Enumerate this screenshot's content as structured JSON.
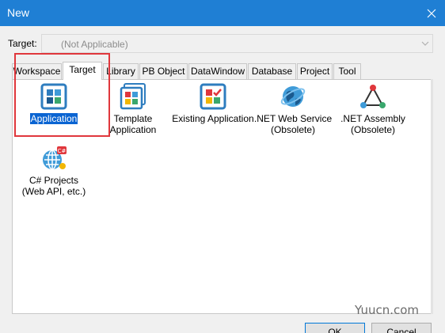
{
  "window": {
    "title": "New"
  },
  "target": {
    "label": "Target:",
    "value": "(Not Applicable)"
  },
  "tabs": [
    {
      "label": "Workspace",
      "active": false
    },
    {
      "label": "Target",
      "active": true
    },
    {
      "label": "Library",
      "active": false
    },
    {
      "label": "PB Object",
      "active": false
    },
    {
      "label": "DataWindow",
      "active": false
    },
    {
      "label": "Database",
      "active": false
    },
    {
      "label": "Project",
      "active": false
    },
    {
      "label": "Tool",
      "active": false
    }
  ],
  "items": [
    {
      "label": "Application",
      "icon": "application-icon",
      "selected": true
    },
    {
      "label": "Template\nApplication",
      "icon": "template-application-icon",
      "selected": false
    },
    {
      "label": "Existing Application",
      "icon": "existing-application-icon",
      "selected": false
    },
    {
      "label": ".NET Web Service\n(Obsolete)",
      "icon": "globe-icon",
      "selected": false
    },
    {
      "label": ".NET Assembly\n(Obsolete)",
      "icon": "assembly-triangle-icon",
      "selected": false
    },
    {
      "label": "C# Projects\n(Web API, etc.)",
      "icon": "csharp-projects-icon",
      "selected": false
    }
  ],
  "buttons": {
    "ok": "OK",
    "cancel": "Cancel"
  },
  "watermark": "Yuucn.com",
  "colors": {
    "titlebar": "#1f7fd4",
    "selection": "#0a64d2",
    "highlight": "#e0373c"
  }
}
